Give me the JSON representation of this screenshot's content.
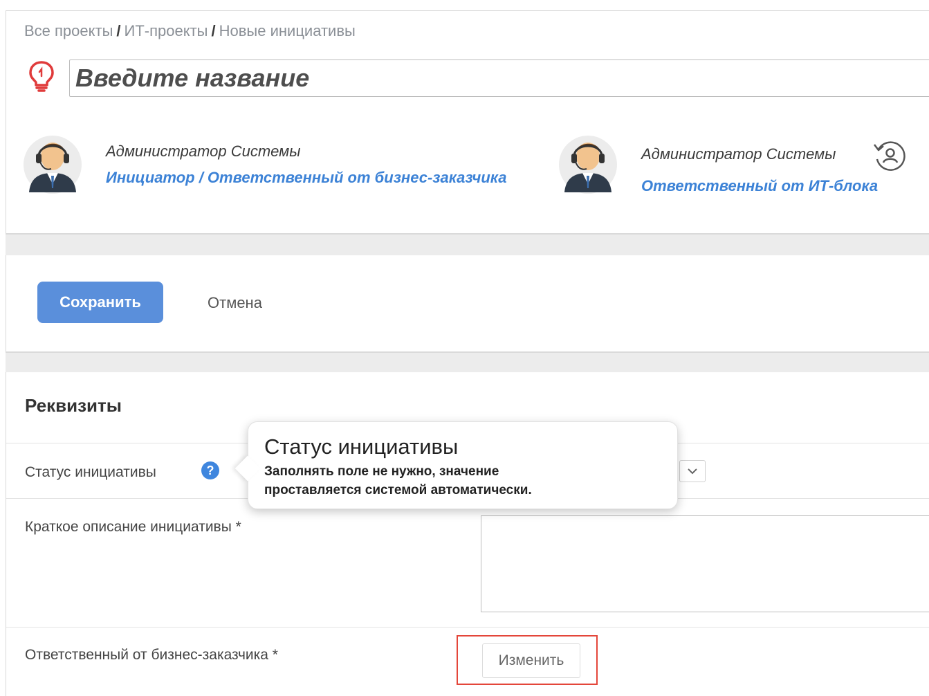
{
  "breadcrumb": {
    "items": [
      "Все проекты",
      "ИТ-проекты",
      "Новые инициативы"
    ],
    "separator": "/"
  },
  "title_field": {
    "placeholder": "Введите название",
    "value": ""
  },
  "people": [
    {
      "name": "Администратор Системы",
      "role": "Инициатор / Ответственный от бизнес-заказчика"
    },
    {
      "name": "Администратор Системы",
      "role": "Ответственный от ИТ-блока"
    }
  ],
  "actions": {
    "save_label": "Сохранить",
    "cancel_label": "Отмена"
  },
  "requisites": {
    "section_title": "Реквизиты",
    "status_label": "Статус инициативы",
    "description_label": "Краткое описание инициативы *",
    "responsible_label": "Ответственный от бизнес-заказчика *",
    "change_label": "Изменить",
    "help_icon_glyph": "?"
  },
  "tooltip": {
    "title": "Статус инициативы",
    "line1": "Заполнять поле не нужно, значение",
    "line2": "проставляется системой автоматически."
  },
  "colors": {
    "accent": "#3c82d6",
    "save_button": "#5a8fdb",
    "idea_icon": "#e03b3b",
    "highlight": "#e4463a"
  },
  "icons": {
    "idea": "lightbulb-icon",
    "change_responsible": "user-rotate-icon",
    "help": "question-circle-icon",
    "dropdown": "chevron-down-icon"
  }
}
